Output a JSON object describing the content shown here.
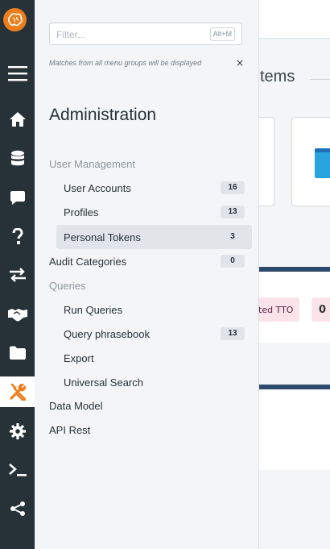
{
  "rail": {
    "items": [
      {
        "icon": "menu-icon",
        "active": false
      },
      {
        "icon": "home-icon",
        "active": false
      },
      {
        "icon": "database-icon",
        "active": false
      },
      {
        "icon": "chat-icon",
        "active": false
      },
      {
        "icon": "question-icon",
        "active": false
      },
      {
        "icon": "exchange-icon",
        "active": false
      },
      {
        "icon": "handshake-icon",
        "active": false
      },
      {
        "icon": "folder-icon",
        "active": false
      },
      {
        "icon": "tools-icon",
        "active": true
      },
      {
        "icon": "gear-icon",
        "active": false
      },
      {
        "icon": "terminal-icon",
        "active": false
      },
      {
        "icon": "share-icon",
        "active": false
      }
    ],
    "accent": "#ec7e1d",
    "background": "#263238"
  },
  "menu": {
    "filter": {
      "placeholder": "Filter...",
      "value": "",
      "shortcut": "Alt+M"
    },
    "hint": "Matches from all menu groups will be displayed",
    "close_label": "×",
    "title": "Administration",
    "items": [
      {
        "label": "User Management",
        "kind": "group"
      },
      {
        "label": "User Accounts",
        "kind": "sub",
        "badge": "16"
      },
      {
        "label": "Profiles",
        "kind": "sub",
        "badge": "13"
      },
      {
        "label": "Personal Tokens",
        "kind": "sub",
        "badge": "3",
        "active": true
      },
      {
        "label": "Audit Categories",
        "kind": "top",
        "badge": "0"
      },
      {
        "label": "Queries",
        "kind": "group"
      },
      {
        "label": "Run Queries",
        "kind": "sub"
      },
      {
        "label": "Query phrasebook",
        "kind": "sub",
        "badge": "13"
      },
      {
        "label": "Export",
        "kind": "sub"
      },
      {
        "label": "Universal Search",
        "kind": "sub"
      },
      {
        "label": "Data Model",
        "kind": "top"
      },
      {
        "label": "API Rest",
        "kind": "top"
      }
    ]
  },
  "background": {
    "heading": "tems",
    "chip_label": "ted TTO",
    "chip_value": "0"
  }
}
